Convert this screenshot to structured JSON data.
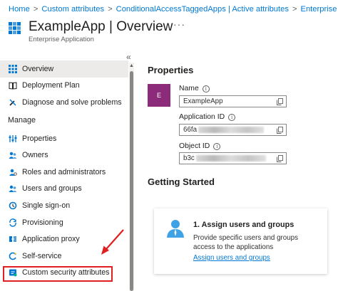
{
  "breadcrumb": {
    "items": [
      "Home",
      "Custom attributes",
      "ConditionalAccessTaggedApps | Active attributes",
      "Enterprise applicati"
    ],
    "separator": ">"
  },
  "header": {
    "title": "ExampleApp | Overview",
    "subtitle": "Enterprise Application",
    "more": "···"
  },
  "sidebar": {
    "collapse": "«",
    "top_items": [
      {
        "label": "Overview",
        "icon": "grid-icon"
      },
      {
        "label": "Deployment Plan",
        "icon": "book-icon"
      },
      {
        "label": "Diagnose and solve problems",
        "icon": "wrench-icon"
      }
    ],
    "section": "Manage",
    "manage_items": [
      {
        "label": "Properties",
        "icon": "properties-icon"
      },
      {
        "label": "Owners",
        "icon": "owners-icon"
      },
      {
        "label": "Roles and administrators",
        "icon": "roles-icon"
      },
      {
        "label": "Users and groups",
        "icon": "users-icon"
      },
      {
        "label": "Single sign-on",
        "icon": "sso-icon"
      },
      {
        "label": "Provisioning",
        "icon": "provisioning-icon"
      },
      {
        "label": "Application proxy",
        "icon": "proxy-icon"
      },
      {
        "label": "Self-service",
        "icon": "self-service-icon"
      },
      {
        "label": "Custom security attributes",
        "icon": "security-attributes-icon"
      }
    ]
  },
  "properties": {
    "heading": "Properties",
    "avatar_letter": "E",
    "name_label": "Name",
    "name_value": "ExampleApp",
    "appid_label": "Application ID",
    "appid_value": "66fa",
    "objectid_label": "Object ID",
    "objectid_value": "b3c"
  },
  "getting_started": {
    "heading": "Getting Started",
    "card_title": "1. Assign users and groups",
    "card_desc": "Provide specific users and groups access to the applications",
    "card_link": "Assign users and groups"
  },
  "colors": {
    "accent": "#0078d4",
    "avatar": "#8b2b7a",
    "highlight": "#e02020"
  }
}
